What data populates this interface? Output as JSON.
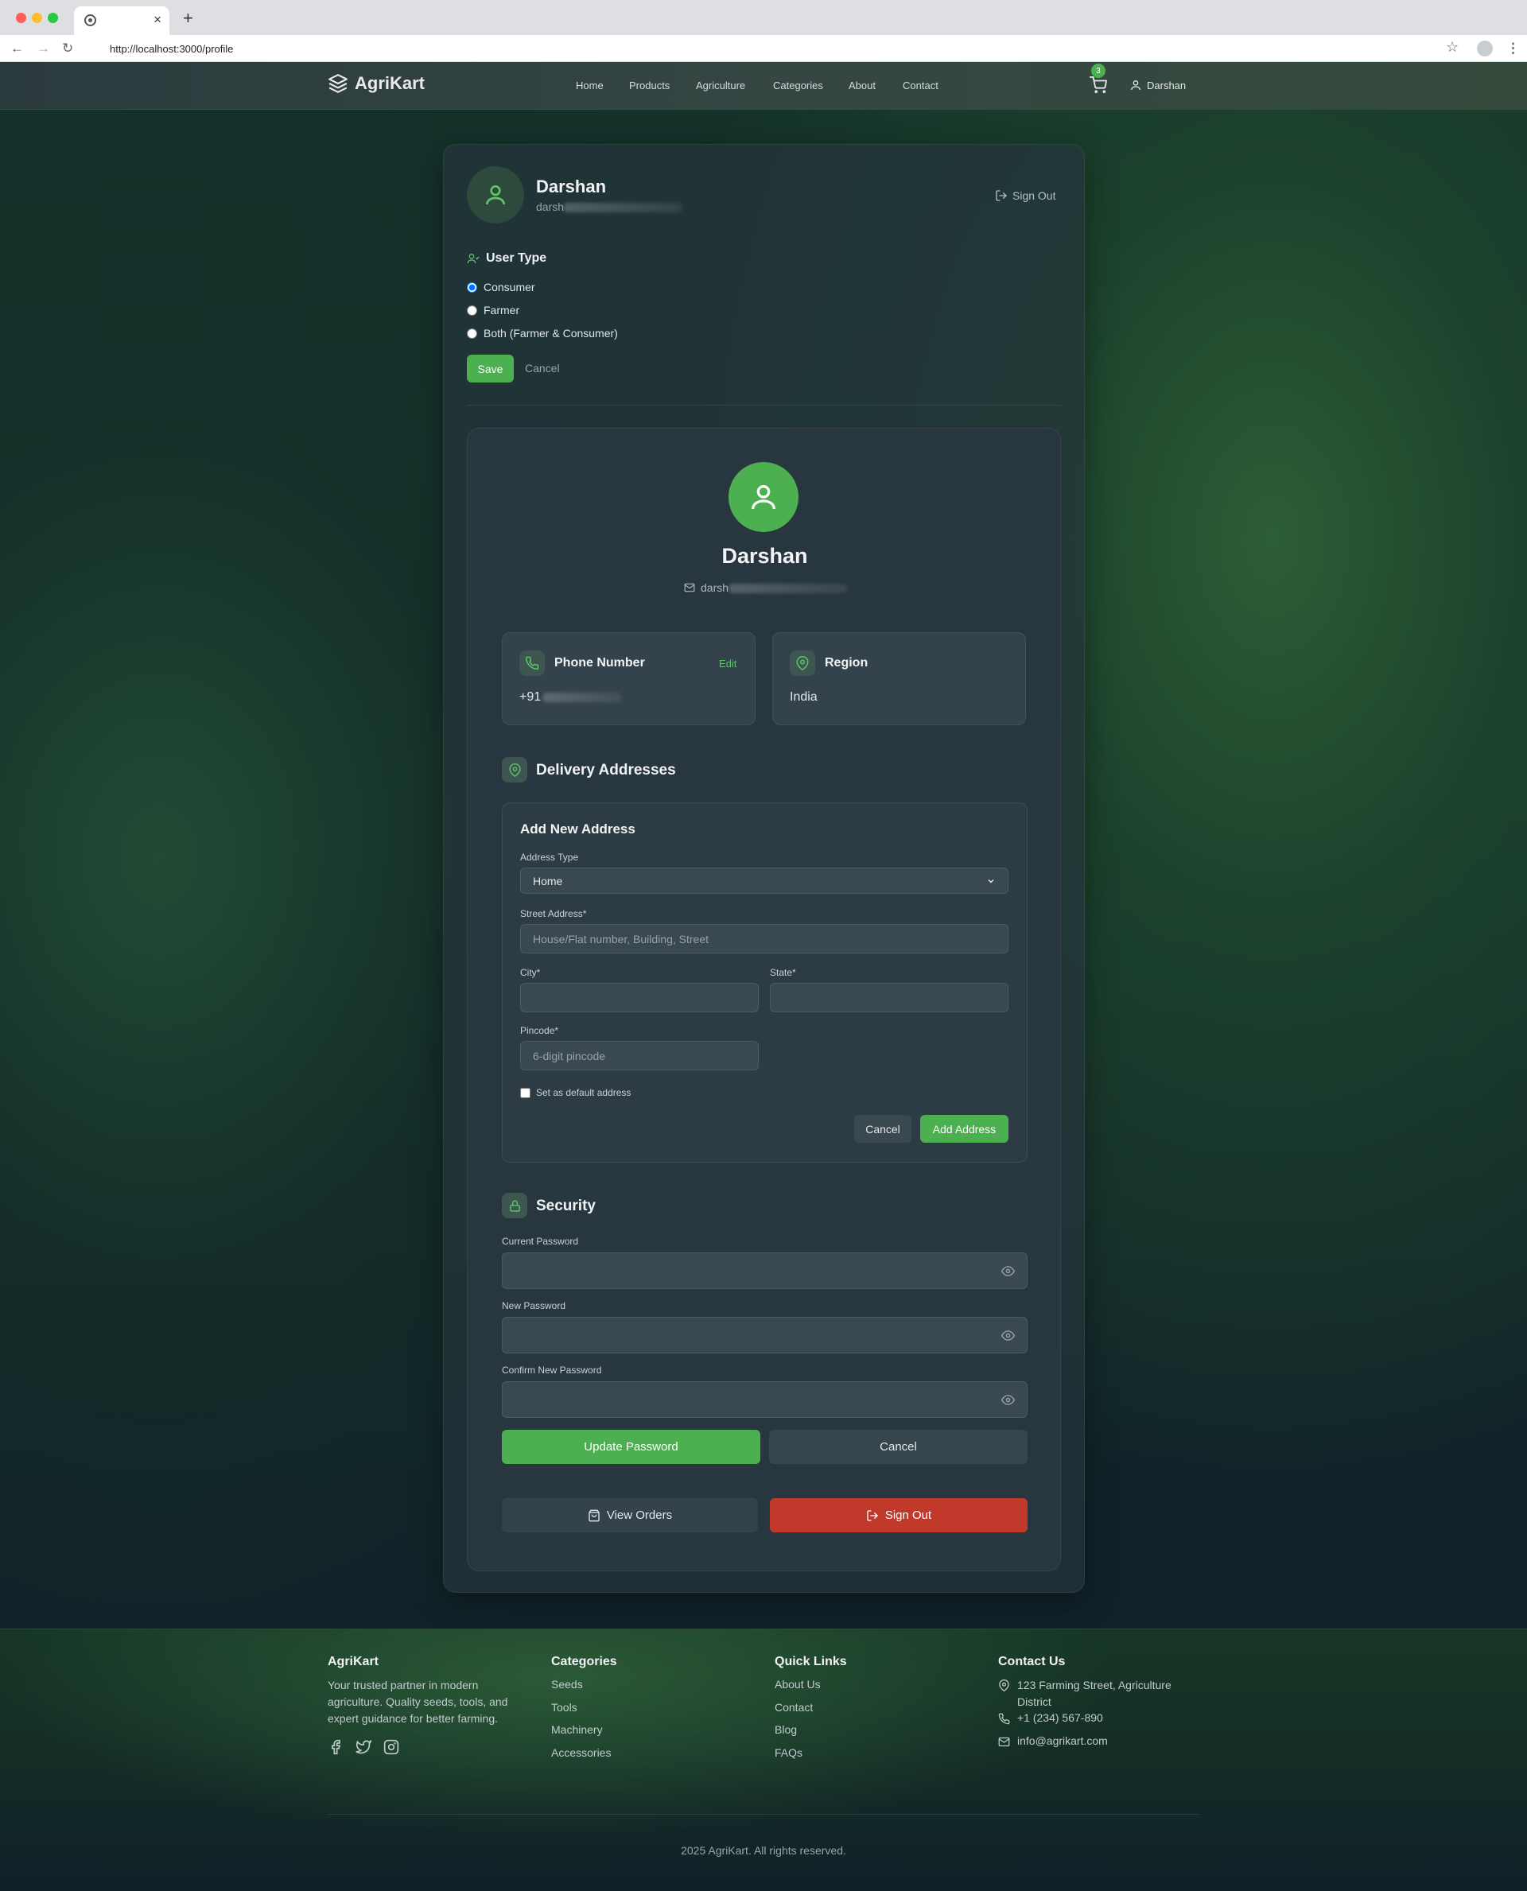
{
  "browser": {
    "url": "http://localhost:3000/profile"
  },
  "header": {
    "brand": "AgriKart",
    "nav": [
      "Home",
      "Products",
      "Agriculture",
      "Categories",
      "About",
      "Contact"
    ],
    "cart_count": "3",
    "user_name": "Darshan"
  },
  "profile": {
    "name": "Darshan",
    "email_visible": "darsh",
    "sign_out": "Sign Out",
    "user_type": {
      "title": "User Type",
      "options": [
        "Consumer",
        "Farmer",
        "Both (Farmer & Consumer)"
      ],
      "selected": "Consumer",
      "save": "Save",
      "cancel": "Cancel"
    }
  },
  "details": {
    "name": "Darshan",
    "email_visible": "darsh",
    "phone": {
      "title": "Phone Number",
      "edit": "Edit",
      "value_visible": "+91"
    },
    "region": {
      "title": "Region",
      "value": "India"
    }
  },
  "addresses": {
    "title": "Delivery Addresses",
    "form_title": "Add New Address",
    "address_type_label": "Address Type",
    "address_type_value": "Home",
    "street_label": "Street Address*",
    "street_placeholder": "House/Flat number, Building, Street",
    "city_label": "City*",
    "state_label": "State*",
    "pincode_label": "Pincode*",
    "pincode_placeholder": "6-digit pincode",
    "default_label": "Set as default address",
    "cancel": "Cancel",
    "add": "Add Address"
  },
  "security": {
    "title": "Security",
    "current_label": "Current Password",
    "new_label": "New Password",
    "confirm_label": "Confirm New Password",
    "update": "Update Password",
    "cancel": "Cancel"
  },
  "actions": {
    "view_orders": "View Orders",
    "sign_out": "Sign Out"
  },
  "footer": {
    "brand": "AgriKart",
    "tagline": "Your trusted partner in modern agriculture. Quality seeds, tools, and expert guidance for better farming.",
    "categories_title": "Categories",
    "categories": [
      "Seeds",
      "Tools",
      "Machinery",
      "Accessories"
    ],
    "links_title": "Quick Links",
    "links": [
      "About Us",
      "Contact",
      "Blog",
      "FAQs"
    ],
    "contact_title": "Contact Us",
    "address": "123 Farming Street, Agriculture District",
    "phone": "+1 (234) 567-890",
    "email": "info@agrikart.com",
    "copyright": "2025 AgriKart. All rights reserved."
  },
  "colors": {
    "accent_green": "#4caf50",
    "danger_red": "#c0392b"
  }
}
